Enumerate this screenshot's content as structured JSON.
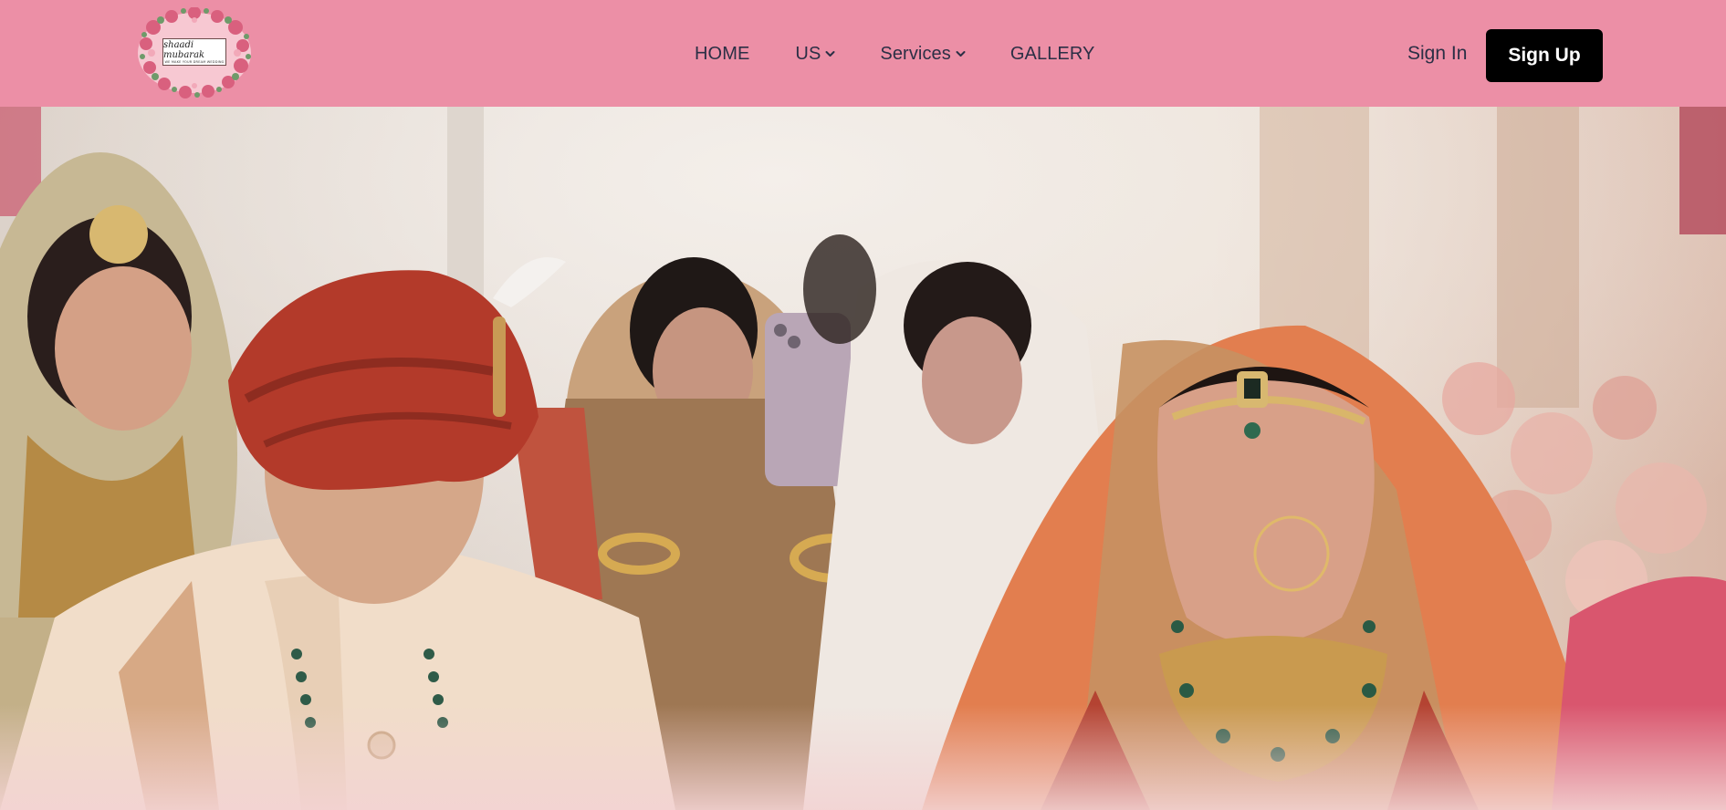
{
  "brand": {
    "logo_script": "shaadi mubarak",
    "logo_tagline": "WE MAKE YOUR DREAM WEDDING"
  },
  "nav": {
    "items": [
      {
        "label": "HOME",
        "has_dropdown": false
      },
      {
        "label": "US",
        "has_dropdown": true
      },
      {
        "label": "Services",
        "has_dropdown": true
      },
      {
        "label": "GALLERY",
        "has_dropdown": false
      }
    ]
  },
  "auth": {
    "signin_label": "Sign In",
    "signup_label": "Sign Up"
  },
  "colors": {
    "header_bg": "#ec8fa6",
    "nav_text": "#2b2f45",
    "signup_bg": "#000000",
    "signup_text": "#ffffff"
  },
  "icons": {
    "dropdown": "chevron-down-icon"
  }
}
